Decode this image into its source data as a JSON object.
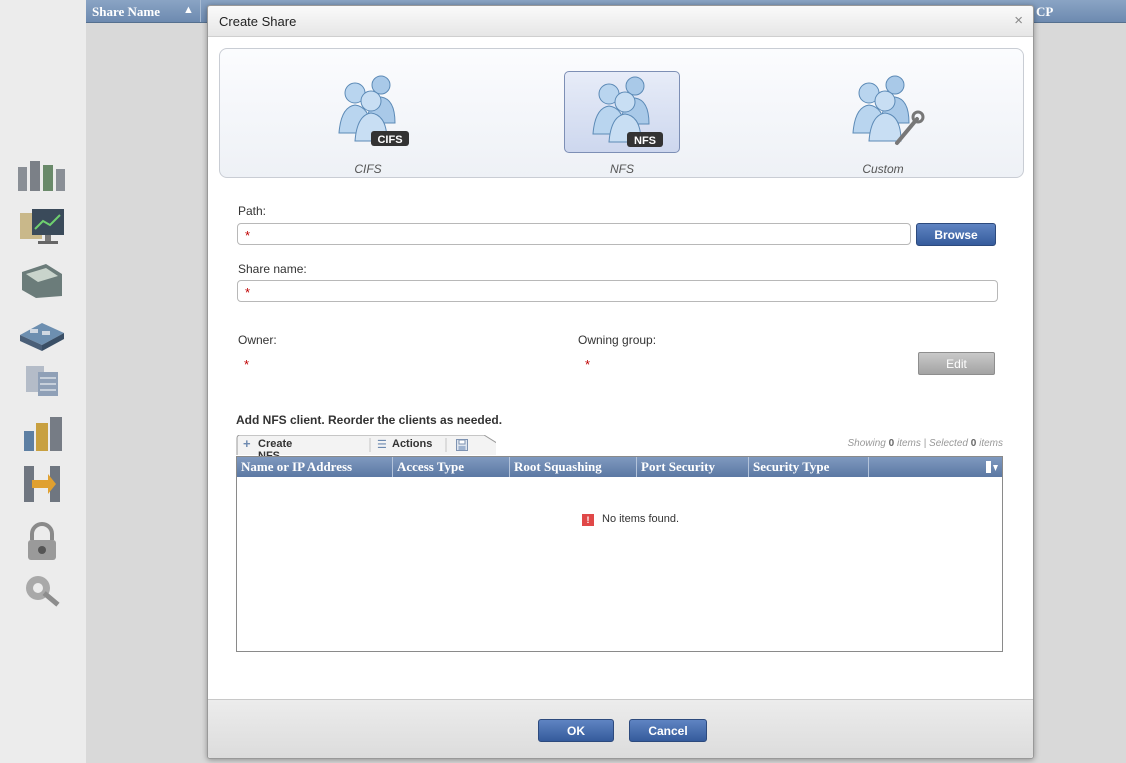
{
  "background": {
    "columns": [
      {
        "label": "Share Name",
        "sort": "asc"
      },
      {
        "label": "CP"
      }
    ],
    "sidebar_icons": [
      "servers-icon",
      "monitoring-icon",
      "files-icon",
      "storage-icon",
      "database-icon",
      "archive-icon",
      "migration-icon",
      "lock-icon",
      "settings-icon"
    ]
  },
  "dialog": {
    "title": "Create Share",
    "close_symbol": "×",
    "types": [
      {
        "label": "CIFS",
        "badge": "CIFS",
        "selected": false
      },
      {
        "label": "NFS",
        "badge": "NFS",
        "selected": true
      },
      {
        "label": "Custom",
        "badge": "",
        "selected": false
      }
    ],
    "path": {
      "label": "Path:",
      "value": "",
      "required_mark": "*",
      "browse_label": "Browse"
    },
    "share_name": {
      "label": "Share name:",
      "value": "",
      "required_mark": "*"
    },
    "owner": {
      "label": "Owner:",
      "value": "",
      "required_mark": "*"
    },
    "owning_group": {
      "label": "Owning group:",
      "value": "",
      "required_mark": "*"
    },
    "edit_label": "Edit",
    "nfs_clients": {
      "heading": "Add NFS client. Reorder the clients as needed.",
      "create_label": "Create NFS client",
      "actions_label": "Actions",
      "showing": {
        "prefix": "Showing",
        "count": "0",
        "items_word": "items |",
        "selected_prefix": "Selected",
        "selected_count": "0",
        "selected_word": "items"
      },
      "columns": [
        "Name or IP Address",
        "Access Type",
        "Root Squashing",
        "Port Security",
        "Security Type"
      ],
      "rows": [],
      "empty_message": "No items found."
    },
    "ok_label": "OK",
    "cancel_label": "Cancel"
  },
  "colors": {
    "accent": "#355b9c",
    "header": "#6d8ab0",
    "required": "#c00000"
  }
}
